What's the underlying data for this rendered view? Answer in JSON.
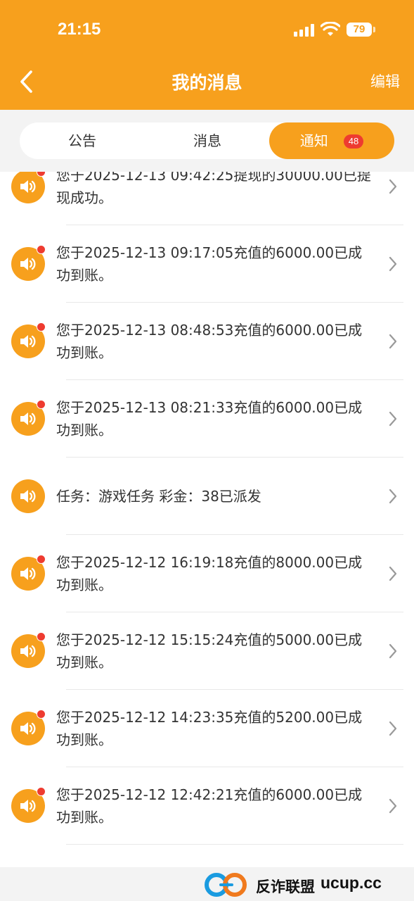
{
  "status_bar": {
    "time": "21:15",
    "battery": "79"
  },
  "header": {
    "title": "我的消息",
    "edit_label": "编辑",
    "color": "#f7a01d"
  },
  "tabs": [
    {
      "label": "公告",
      "active": false
    },
    {
      "label": "消息",
      "active": false
    },
    {
      "label": "通知",
      "active": true,
      "badge": "48"
    }
  ],
  "messages": [
    {
      "text": "您于2025-12-13 09:42:25提现的30000.00已提现成功。",
      "unread": true
    },
    {
      "text": "您于2025-12-13 09:17:05充值的6000.00已成功到账。",
      "unread": true
    },
    {
      "text": "您于2025-12-13 08:48:53充值的6000.00已成功到账。",
      "unread": true
    },
    {
      "text": "您于2025-12-13 08:21:33充值的6000.00已成功到账。",
      "unread": true
    },
    {
      "text": "任务：游戏任务 彩金：38已派发",
      "unread": false
    },
    {
      "text": "您于2025-12-12 16:19:18充值的8000.00已成功到账。",
      "unread": true
    },
    {
      "text": "您于2025-12-12 15:15:24充值的5000.00已成功到账。",
      "unread": true
    },
    {
      "text": "您于2025-12-12 14:23:35充值的5200.00已成功到账。",
      "unread": true
    },
    {
      "text": "您于2025-12-12 12:42:21充值的6000.00已成功到账。",
      "unread": true
    }
  ],
  "footer": {
    "brand": "反诈联盟",
    "url": "ucup.cc"
  },
  "icons": {
    "back": "chevron-left-icon",
    "message": "speaker-icon",
    "arrow": "chevron-right-icon"
  }
}
